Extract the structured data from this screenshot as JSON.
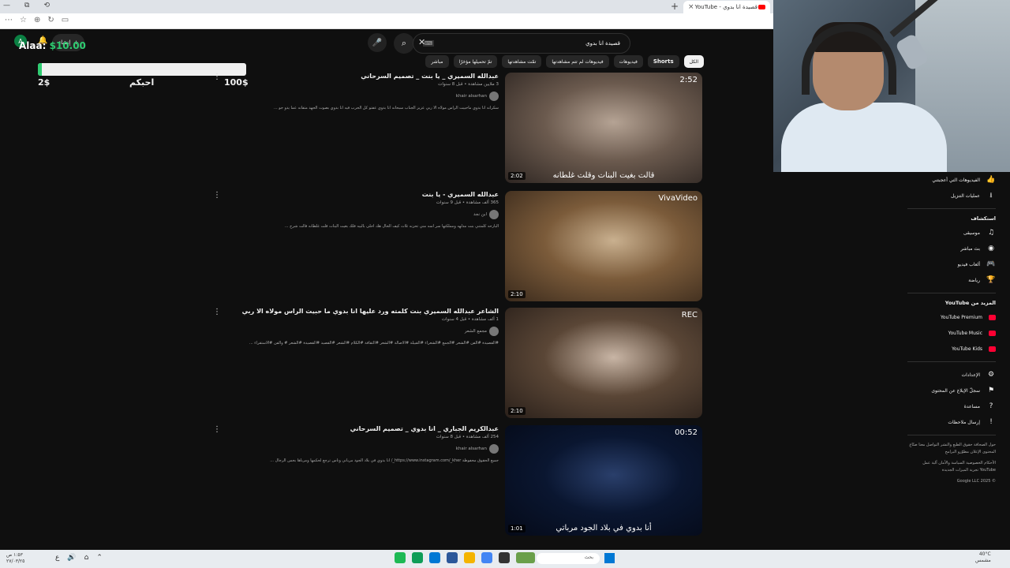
{
  "browser": {
    "tab_title": "قصيدة انا بدوي - YouTube",
    "new_tab": "+",
    "tab_close": "×",
    "window_controls": [
      "—",
      "⧉",
      "⟲"
    ],
    "addr_icons": [
      "⋯",
      "☆",
      "⊕",
      "↻",
      "▭"
    ]
  },
  "overlay": {
    "label": "Alaa:",
    "amount": "$10.00",
    "goal_progress_percent": 2,
    "goal_min": "2$",
    "goal_name": "احبكم",
    "goal_max": "100$"
  },
  "header": {
    "search_query": "قصيدة انا بدوي",
    "keyboard_hint": "⌨",
    "create_label": "إنشاء",
    "avatar_letter": "A"
  },
  "chips": [
    {
      "label": "الكل",
      "active": true
    },
    {
      "label": "Shorts",
      "active": false,
      "bold": true
    },
    {
      "label": "فيديوهات",
      "active": false
    },
    {
      "label": "فيديوهات لم تتم مشاهدتها",
      "active": false
    },
    {
      "label": "تمّت مشاهدتها",
      "active": false
    },
    {
      "label": "تمّ تحميلها مؤخرًا",
      "active": false
    },
    {
      "label": "مباشر",
      "active": false
    }
  ],
  "results": [
    {
      "title": "عبدالله السميري _ يا بنت _ تصميم السرحاني",
      "meta": "3 ملايين مشاهدة • قبل 8 سنوات",
      "channel": "khair alsarhan",
      "desc": "سكرانه انا بدوي ماحبيت الراس مولاه الا ربي عزيز الجناب سبحانه انا بدوي عفتو كل الحرب فيه انا بدوي بصوت الجهد متفانه عما يدو جو ...",
      "caption": "قالت بغيت البنات وقلت غلطانه",
      "duration": "2:02",
      "corner": "2:52",
      "colors": [
        "#6b5a4e",
        "#b5a394",
        "#2e2622"
      ]
    },
    {
      "title": "عبدالله السميري - يا بنت",
      "meta": "365 ألف مشاهدة • قبل 9 سنوات",
      "channel": "ابن نجد",
      "desc": "البارحه كلمتني بنت مدلهه ومملكتها سر اسه مني تحزنه ثلاث كيف الحال هك احلى بالبيه فلك بغيت البنات قلت غلطانه قالت شرح ...",
      "caption": "",
      "duration": "2:10",
      "corner": "VivaVideo",
      "colors": [
        "#7b5b3a",
        "#c9b08f",
        "#3a2a1c"
      ]
    },
    {
      "title": "الشاعر عبدالله السميري بنت كلمته ورد عليها انا بدوي ما حبيت الراس مولاه الا ربي",
      "meta": "1 ألف مشاهدة • قبل 4 سنوات",
      "channel": "مجمع الشعر",
      "desc": "#القصيدة #الفن #الشعر #الجمع #الشعراء #القبيلة #الاصالة #الشعر #الثقافة #الكلام #الشعر #القصيد #القصيدة #الشعر # والفن #الاستقراء ...",
      "caption": "",
      "duration": "2:10",
      "corner": "REC",
      "colors": [
        "#5a4636",
        "#c8b5a5",
        "#2a201a"
      ]
    },
    {
      "title": "عبدالكريم الجباري _ انا بدوي _ تصميم السرحاني",
      "meta": "254 ألف مشاهدة • قبل 8 سنوات",
      "channel": "khair alsarhan",
      "desc": "جميع الحقوق محفوظة https://www.instagram.com/_kher_/ انا بدوي في بلاد الجود مرباني وناس ترجع لحكمها ومرباها بحس الرجال ...",
      "caption": "أنا بدوي في بلاد الجود مرباتي",
      "duration": "1:01",
      "corner": "00:52",
      "colors": [
        "#0a1630",
        "#2a3f6b",
        "#050a18"
      ]
    }
  ],
  "kebab": "⋮",
  "sidebar": {
    "top_items": [
      {
        "label": "الفيديوهات التي أعجبتني",
        "icon": "thumbs-up-icon",
        "glyph": "👍"
      },
      {
        "label": "عمليات التنزيل",
        "icon": "download-icon",
        "glyph": "⭳"
      }
    ],
    "explore_heading": "استكشاف",
    "explore_items": [
      {
        "label": "موسيقى",
        "icon": "music-icon",
        "glyph": "♫"
      },
      {
        "label": "بث مباشر",
        "icon": "live-icon",
        "glyph": "◉"
      },
      {
        "label": "ألعاب فيديو",
        "icon": "gamepad-icon",
        "glyph": "🎮"
      },
      {
        "label": "رياضة",
        "icon": "trophy-icon",
        "glyph": "🏆"
      }
    ],
    "more_heading": "المزيد من YouTube",
    "more_items": [
      {
        "label": "YouTube Premium",
        "color": "#ff0033"
      },
      {
        "label": "YouTube Music",
        "color": "#ff0033"
      },
      {
        "label": "YouTube Kids",
        "color": "#ff0033"
      }
    ],
    "settings_items": [
      {
        "label": "الإعدادات",
        "icon": "gear-icon",
        "glyph": "⚙"
      },
      {
        "label": "سجلّ الإبلاغ عن المحتوى",
        "icon": "flag-icon",
        "glyph": "⚑"
      },
      {
        "label": "مساعدة",
        "icon": "help-icon",
        "glyph": "?"
      },
      {
        "label": "إرسال ملاحظات",
        "icon": "feedback-icon",
        "glyph": "!"
      }
    ],
    "footer_1": "حول  الصحافة  حقوق الطبع والنشر التواصل معنا  صنّاع المحتوى  الإعلان مطوّرو البرامج",
    "footer_2": "الأحكام  الخصوصية  السياسة والأمان آلية عمل YouTube  تجربة الميزات الجديدة",
    "copyright": "© 2025 Google LLC"
  },
  "taskbar": {
    "time": "١:٥٣ ص",
    "date": "٢٧/٠٣/٢٥",
    "search_placeholder": "بحث",
    "weather_temp": "40°C",
    "weather_desc": "مشمس"
  }
}
